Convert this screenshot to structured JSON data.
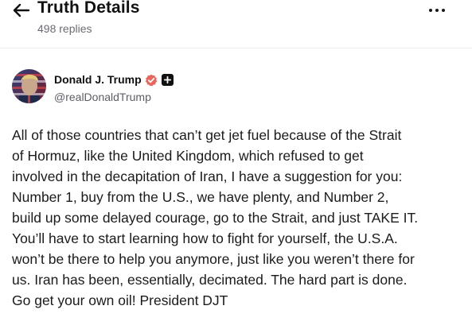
{
  "header": {
    "title": "Truth Details",
    "replies": "498 replies",
    "back_icon": "arrow-left-icon",
    "more_icon": "more-horizontal-icon"
  },
  "post": {
    "author_name": "Donald J. Trump",
    "author_handle": "@realDonaldTrump",
    "verified_icon": "verified-badge-icon",
    "follow_icon": "plus-icon",
    "body": "All of those countries that can’t get jet fuel because of the Strait\nof Hormuz, like the United Kingdom, which refused to get\ninvolved in the decapitation of Iran, I have a suggestion for you:\nNumber 1, buy from the U.S., we have plenty, and Number 2,\nbuild up some delayed courage, go to the Strait, and just TAKE IT.\nYou’ll have to start learning how to fight for yourself, the U.S.A.\nwon’t be there to help you anymore, just like you weren’t there for\nus. Iran has been, essentially, decimated. The hard part is done.\nGo get your own oil! President DJT"
  },
  "colors": {
    "verified_badge": "#e8665c",
    "text_primary": "#111111",
    "text_secondary": "#6b6b75"
  }
}
